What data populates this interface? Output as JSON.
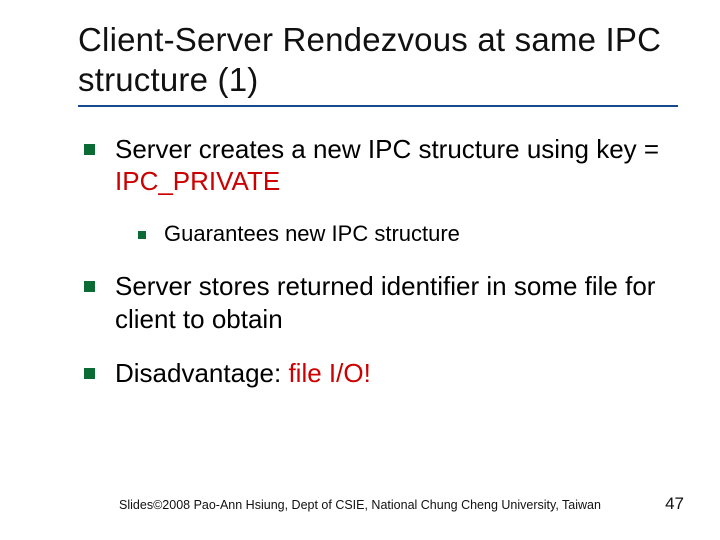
{
  "title": "Client-Server Rendezvous at same IPC structure (1)",
  "bullets": [
    {
      "pre": "Server creates a new IPC structure using key = ",
      "red": "IPC_PRIVATE",
      "post": ""
    },
    {
      "sub": "Guarantees new IPC structure"
    },
    {
      "text": "Server stores returned identifier in some file for client to obtain"
    },
    {
      "pre": "Disadvantage: ",
      "red": "file I/O!",
      "post": ""
    }
  ],
  "footer": "Slides©2008 Pao-Ann Hsiung, Dept of CSIE, National Chung Cheng University, Taiwan",
  "page": "47"
}
